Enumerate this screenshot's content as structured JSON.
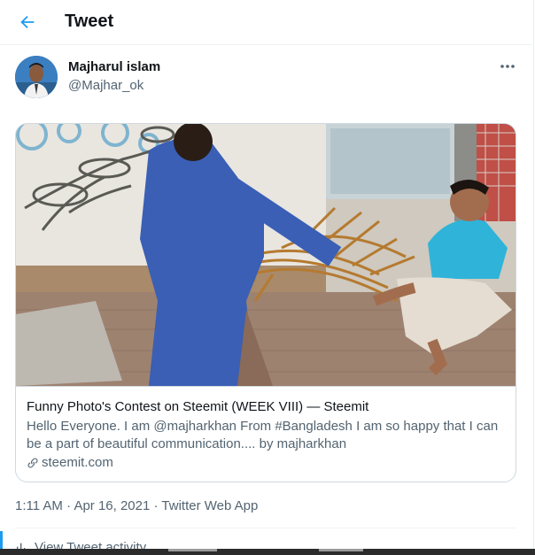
{
  "header": {
    "title": "Tweet"
  },
  "author": {
    "name": "Majharul islam",
    "handle": "@Majhar_ok"
  },
  "card": {
    "title": "Funny Photo's Contest on Steemit (WEEK VIII) — Steemit",
    "description": "Hello Everyone. I am @majharkhan From #Bangladesh I am so happy that I can be a part of beautiful communication.... by majharkhan",
    "domain": "steemit.com"
  },
  "meta": {
    "time": "1:11 AM",
    "date": "Apr 16, 2021",
    "source": "Twitter Web App",
    "separator": "·"
  },
  "activity": {
    "label": "View Tweet activity"
  },
  "colors": {
    "accent": "#1d9bf0",
    "text": "#0f1419",
    "secondary": "#536471",
    "border": "#cfd9de"
  },
  "icons": {
    "back": "arrow-left-icon",
    "more": "more-horizontal-icon",
    "link": "link-icon",
    "activity": "bar-chart-icon"
  }
}
